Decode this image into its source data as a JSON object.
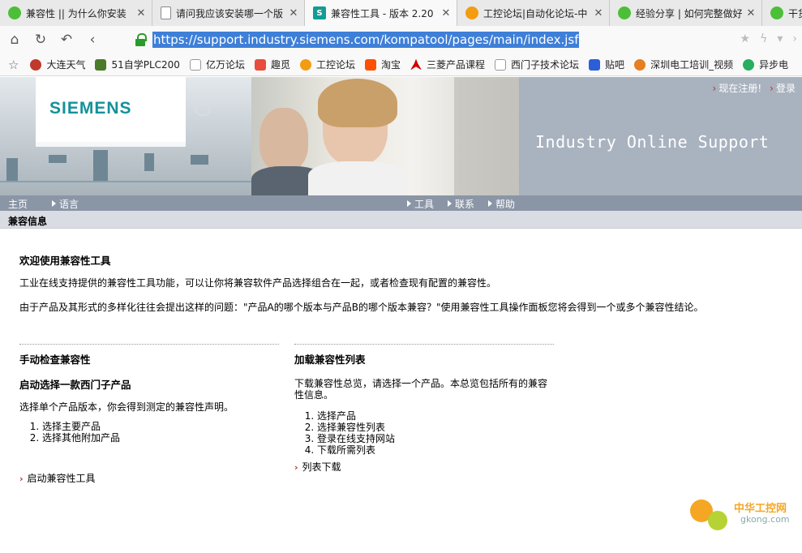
{
  "browser": {
    "tabs": [
      {
        "title": "兼容性 || 为什么你安装",
        "icon": "wechat-icon",
        "active": false
      },
      {
        "title": "请问我应该安装哪一个版",
        "icon": "doc-icon",
        "active": false
      },
      {
        "title": "兼容性工具 - 版本 2.20",
        "icon": "siemens-s-icon",
        "active": true
      },
      {
        "title": "工控论坛|自动化论坛-中",
        "icon": "gear-icon",
        "active": false
      },
      {
        "title": "经验分享 | 如何完整做好",
        "icon": "wechat-icon",
        "active": false
      },
      {
        "title": "干货：",
        "icon": "wechat-icon",
        "active": false
      }
    ],
    "url": "https://support.industry.siemens.com/kompatool/pages/main/index.jsf",
    "bookmarks": [
      {
        "label": "大连天气",
        "color": "#c0392b"
      },
      {
        "label": "51自学PLC200",
        "color": "#4a7a2a"
      },
      {
        "label": "亿万论坛",
        "color": "#777777"
      },
      {
        "label": "趣觅",
        "color": "#e74c3c"
      },
      {
        "label": "工控论坛",
        "color": "#f39c12"
      },
      {
        "label": "淘宝",
        "color": "#ff5000"
      },
      {
        "label": "三菱产品课程",
        "color": "#d00000"
      },
      {
        "label": "西门子技术论坛",
        "color": "#777777"
      },
      {
        "label": "贴吧",
        "color": "#2b5fd9"
      },
      {
        "label": "深圳电工培训_视频",
        "color": "#e67e22"
      },
      {
        "label": "异步电",
        "color": "#27ae60"
      }
    ]
  },
  "page": {
    "logo": "SIEMENS",
    "banner_title": "Industry Online Support",
    "top_links": [
      "现在注册!",
      "登录"
    ],
    "menu_left": [
      "主页",
      "语言"
    ],
    "menu_right": [
      "工具",
      "联系",
      "帮助"
    ],
    "section_title": "兼容信息",
    "welcome_heading": "欢迎使用兼容性工具",
    "intro_1": "工业在线支持提供的兼容性工具功能，可以让你将兼容软件产品选择组合在一起，或者检查现有配置的兼容性。",
    "intro_2": "由于产品及其形式的多样化往往会提出这样的问题：\"产品A的哪个版本与产品B的哪个版本兼容？\"使用兼容性工具操作面板您将会得到一个或多个兼容性结论。",
    "left_col": {
      "heading": "手动检查兼容性",
      "subheading": "启动选择一款西门子产品",
      "text": "选择单个产品版本，你会得到测定的兼容性声明。",
      "steps": [
        "选择主要产品",
        "选择其他附加产品"
      ],
      "link": "启动兼容性工具"
    },
    "right_col": {
      "heading": "加载兼容性列表",
      "text": "下载兼容性总览，请选择一个产品。本总览包括所有的兼容性信息。",
      "steps": [
        "选择产品",
        "选择兼容性列表",
        "登录在线支持网站",
        "下载所需列表"
      ],
      "link": "列表下载"
    },
    "watermark": {
      "line1": "中华工控网",
      "line2": "gkong.com"
    }
  }
}
